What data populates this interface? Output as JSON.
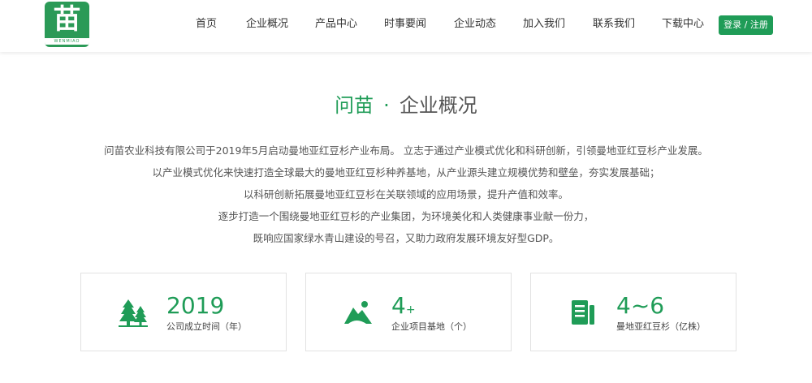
{
  "logo": {
    "char": "苗",
    "text": "WENMIAO"
  },
  "nav": {
    "items": [
      "首页",
      "企业概况",
      "产品中心",
      "时事要闻",
      "企业动态",
      "加入我们",
      "联系我们",
      "下载中心"
    ],
    "login": "登录 / 注册"
  },
  "section": {
    "brand": "问苗",
    "dot": "·",
    "title": "企业概况",
    "lines": [
      "问苗农业科技有限公司于2019年5月启动曼地亚红豆杉产业布局。 立志于通过产业模式优化和科研创新，引领曼地亚红豆杉产业发展。",
      "以产业模式优化来快速打造全球最大的曼地亚红豆杉种养基地，从产业源头建立规模优势和壁垒，夯实发展基础；",
      "以科研创新拓展曼地亚红豆杉在关联领域的应用场景，提升产值和效率。",
      "逐步打造一个围绕曼地亚红豆杉的产业集团，为环境美化和人类健康事业献一份力，",
      "既响应国家绿水青山建设的号召，又助力政府发展环境友好型GDP。"
    ]
  },
  "stats": [
    {
      "icon": "trees-icon",
      "number": "2019",
      "suffix": "",
      "label": "公司成立时间（年）"
    },
    {
      "icon": "landscape-icon",
      "number": "4",
      "suffix": "+",
      "label": "企业项目基地（个）"
    },
    {
      "icon": "document-icon",
      "number": "4~6",
      "suffix": "",
      "label": "曼地亚红豆杉（亿株）"
    }
  ],
  "colors": {
    "accent": "#1f9c57"
  }
}
